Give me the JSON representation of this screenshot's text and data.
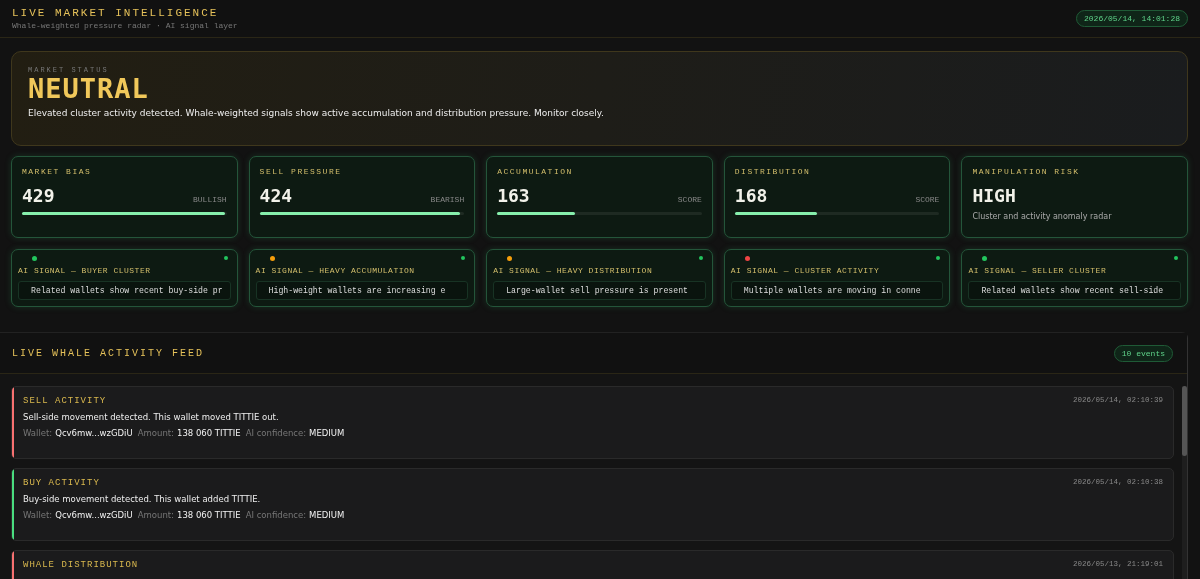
{
  "header": {
    "title": "LIVE MARKET INTELLIGENCE",
    "subtitle": "Whale-weighted pressure radar · AI signal layer",
    "timestamp": "2026/05/14, 14:01:28"
  },
  "status": {
    "label": "MARKET STATUS",
    "value": "NEUTRAL",
    "description": "Elevated cluster activity detected. Whale-weighted signals show active accumulation and distribution pressure. Monitor closely."
  },
  "metrics": [
    {
      "kind": "meter",
      "label": "MARKET BIAS",
      "value": "429",
      "tag": "BULLISH",
      "level": 0.99
    },
    {
      "kind": "meter",
      "label": "SELL PRESSURE",
      "value": "424",
      "tag": "BEARISH",
      "level": 0.98
    },
    {
      "kind": "meter",
      "label": "ACCUMULATION",
      "value": "163",
      "tag": "SCORE",
      "level": 0.38
    },
    {
      "kind": "meter",
      "label": "DISTRIBUTION",
      "value": "168",
      "tag": "SCORE",
      "level": 0.4
    },
    {
      "kind": "text",
      "label": "MANIPULATION RISK",
      "value": "HIGH",
      "note": "Cluster and activity anomaly radar"
    }
  ],
  "signals": [
    {
      "title": "AI SIGNAL — BUYER CLUSTER",
      "message": "Related wallets show recent buy-side pr",
      "color": "#22c55e",
      "live": true
    },
    {
      "title": "AI SIGNAL — HEAVY ACCUMULATION",
      "message": "High-weight wallets are increasing e",
      "color": "#f59e0b",
      "live": true
    },
    {
      "title": "AI SIGNAL — HEAVY DISTRIBUTION",
      "message": "Large-wallet sell pressure is present",
      "color": "#f59e0b",
      "live": true
    },
    {
      "title": "AI SIGNAL — CLUSTER ACTIVITY",
      "message": "Multiple wallets are moving in conne",
      "color": "#ef4444",
      "live": true
    },
    {
      "title": "AI SIGNAL — SELLER CLUSTER",
      "message": "Related wallets show recent sell-side",
      "color": "#22c55e",
      "live": true
    }
  ],
  "feed": {
    "title": "LIVE WHALE ACTIVITY FEED",
    "count": "10 events",
    "events": [
      {
        "title": "SELL ACTIVITY",
        "time": "2026/05/14, 02:10:39",
        "color": "#f87171",
        "description": "Sell-side movement detected. This wallet moved TITTIE out.",
        "details": [
          {
            "label": "Wallet:",
            "value": "Qcv6mw...wzGDiU"
          },
          {
            "label": "Amount:",
            "value": "138 060 TITTIE"
          },
          {
            "label": "AI confidence:",
            "value": "MEDIUM"
          }
        ]
      },
      {
        "title": "BUY ACTIVITY",
        "time": "2026/05/14, 02:10:38",
        "color": "#4ade80",
        "description": "Buy-side movement detected. This wallet added TITTIE.",
        "details": [
          {
            "label": "Wallet:",
            "value": "Qcv6mw...wzGDiU"
          },
          {
            "label": "Amount:",
            "value": "138 060 TITTIE"
          },
          {
            "label": "AI confidence:",
            "value": "MEDIUM"
          }
        ]
      },
      {
        "title": "WHALE DISTRIBUTION",
        "time": "2026/05/13, 21:19:01",
        "color": "#f87171"
      }
    ]
  }
}
